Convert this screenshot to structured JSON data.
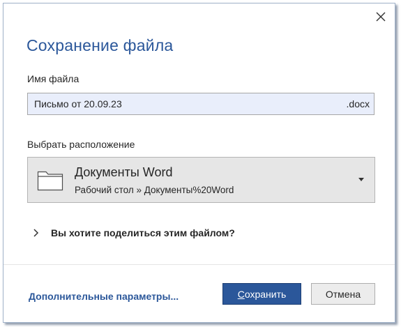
{
  "dialog": {
    "title": "Сохранение файла",
    "close_icon": "close-icon"
  },
  "filename": {
    "label": "Имя файла",
    "value": "Письмо от 20.09.23",
    "extension": ".docx"
  },
  "location": {
    "label": "Выбрать расположение",
    "folder_icon": "folder-icon",
    "name": "Документы Word",
    "path": "Рабочий стол » Документы%20Word",
    "dropdown_icon": "caret-down-icon"
  },
  "share": {
    "chevron_icon": "chevron-right-icon",
    "text": "Вы хотите поделиться этим файлом?"
  },
  "footer": {
    "more_options": "Дополнительные параметры...",
    "save_accel": "С",
    "save_rest": "охранить",
    "cancel": "Отмена"
  },
  "colors": {
    "accent": "#2b579a",
    "filename_bg": "#e9eefb",
    "location_bg": "#e6e6e6"
  }
}
